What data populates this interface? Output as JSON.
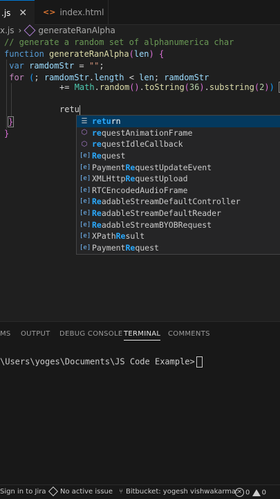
{
  "tabs": [
    {
      "label": ".js",
      "active": true
    },
    {
      "label": "index.html",
      "active": false
    }
  ],
  "breadcrumb": {
    "file": "x.js",
    "symbol": "generateRanAlpha"
  },
  "code": {
    "line1": "// generate a random set of alphanumerica char",
    "l2_kw": "function",
    "l2_fn": "generateRanAlpha",
    "l2_param": "len",
    "l3_kw": "var",
    "l3_var": "ramdomStr",
    "l3_str": "\"\"",
    "l4_kw": "for",
    "l4_var": "ramdomStr",
    "l4_prop": "length",
    "l4_len": "len",
    "l4_var2": "ramdomStr",
    "l5_obj": "Math",
    "l5_m1": "random",
    "l5_m2": "toString",
    "l5_n1": "36",
    "l5_m3": "substring",
    "l5_n2": "2",
    "l6_typed": "retu"
  },
  "suggestions": [
    {
      "kind": "kw",
      "pre": "",
      "hl": "retu",
      "post": "rn"
    },
    {
      "kind": "method",
      "pre": "",
      "hl": "re",
      "post": "questAnimationFrame"
    },
    {
      "kind": "method",
      "pre": "",
      "hl": "re",
      "post": "questIdleCallback"
    },
    {
      "kind": "var",
      "pre": "",
      "hl": "Re",
      "post": "quest"
    },
    {
      "kind": "var",
      "pre": "Payment",
      "hl": "Re",
      "post": "questUpdateEvent"
    },
    {
      "kind": "var",
      "pre": "XMLHttp",
      "hl": "Re",
      "post": "questUpload"
    },
    {
      "kind": "var",
      "pre": "RTCEncodedAudioFrame",
      "hl": "",
      "post": ""
    },
    {
      "kind": "var",
      "pre": "",
      "hl": "Re",
      "post": "adableStreamDefaultController"
    },
    {
      "kind": "var",
      "pre": "",
      "hl": "Re",
      "post": "adableStreamDefaultReader"
    },
    {
      "kind": "var",
      "pre": "",
      "hl": "Re",
      "post": "adableStreamBYOBRequest"
    },
    {
      "kind": "var",
      "pre": "XPath",
      "hl": "Re",
      "post": "sult"
    },
    {
      "kind": "var",
      "pre": "Payment",
      "hl": "Re",
      "post": "quest"
    }
  ],
  "panel": {
    "tabs": [
      "MS",
      "OUTPUT",
      "DEBUG CONSOLE",
      "TERMINAL",
      "COMMENTS"
    ],
    "active_tab": "TERMINAL",
    "terminal_prompt": "\\Users\\yoges\\Documents\\JS Code Example>"
  },
  "status": {
    "jira": "Sign in to Jira",
    "issue": "No active issue",
    "bitbucket": "Bitbucket: yogesh vishwakarma:",
    "errors": "0",
    "warnings": "0"
  },
  "colors": {
    "accent": "#0078d4",
    "selection": "#04395e"
  }
}
